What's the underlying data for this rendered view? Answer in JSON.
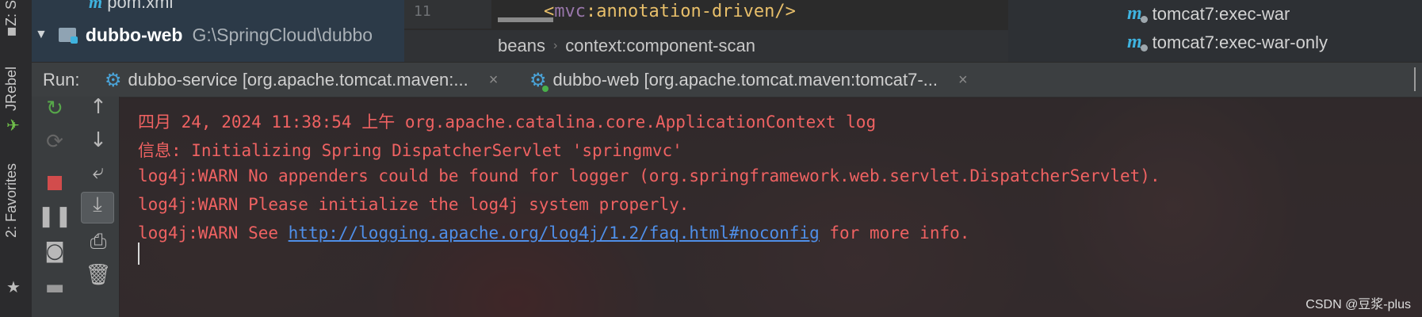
{
  "project": {
    "pom_file": "pom.xml",
    "module_name": "dubbo-web",
    "module_path": "G:\\SpringCloud\\dubbo"
  },
  "editor": {
    "line_number": "11",
    "code_prefix": "<",
    "code_ns": "mvc",
    "code_rest": ":annotation-driven/>",
    "breadcrumb": [
      "beans",
      "context:component-scan"
    ]
  },
  "maven": {
    "goals": [
      "tomcat7:exec-war",
      "tomcat7:exec-war-only"
    ]
  },
  "left_strip": {
    "tabs": [
      "Z: S",
      "JRebel",
      "2: Favorites"
    ]
  },
  "run": {
    "label": "Run:",
    "tabs": [
      {
        "label": "dubbo-service [org.apache.tomcat.maven:..."
      },
      {
        "label": "dubbo-web [org.apache.tomcat.maven:tomcat7-..."
      }
    ],
    "close_glyph": "×"
  },
  "console": {
    "lines": [
      "四月 24, 2024 11:38:54 上午 org.apache.catalina.core.ApplicationContext log",
      "信息: Initializing Spring DispatcherServlet 'springmvc'",
      "log4j:WARN No appenders could be found for logger (org.springframework.web.servlet.DispatcherServlet).",
      "log4j:WARN Please initialize the log4j system properly."
    ],
    "last_line_prefix": "log4j:WARN See ",
    "last_line_link": "http://logging.apache.org/log4j/1.2/faq.html#noconfig",
    "last_line_suffix": " for more info."
  },
  "watermark": "CSDN @豆浆-plus",
  "colors": {
    "error_text": "#ef6262",
    "link": "#4f8fe8",
    "maven_icon": "#3fb3df"
  }
}
